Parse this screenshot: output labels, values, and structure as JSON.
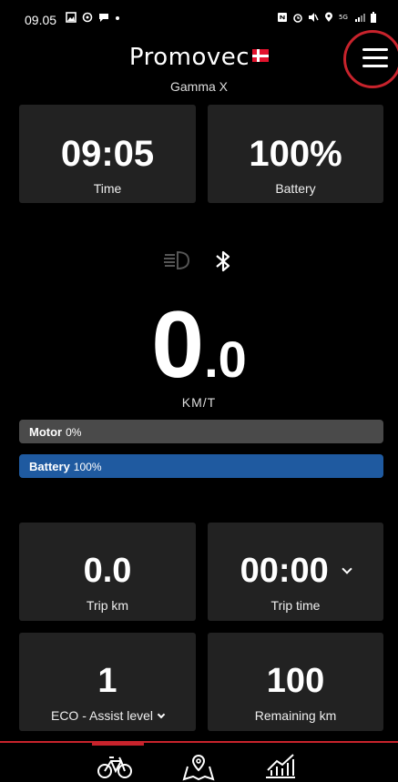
{
  "status_bar": {
    "time": "09.05",
    "icons": [
      "gallery-icon",
      "sync-icon",
      "chat-icon",
      "dot-icon",
      "nfc-icon",
      "alarm-icon",
      "mute-icon",
      "location-icon",
      "5g-icon",
      "signal-icon",
      "battery-icon"
    ]
  },
  "header": {
    "brand": "Promovec",
    "model": "Gamma X",
    "menu_icon": "hamburger-menu-icon",
    "accent_color": "#c8232c"
  },
  "tiles_top": [
    {
      "value": "09:05",
      "label": "Time"
    },
    {
      "value": "100%",
      "label": "Battery"
    }
  ],
  "status_icons": [
    "headlight-icon",
    "bluetooth-icon"
  ],
  "speed": {
    "integer": "0",
    "decimal": ".0",
    "unit": "KM/T"
  },
  "bars": {
    "motor": {
      "label": "Motor",
      "value_text": "0%",
      "fraction": 0.0,
      "color": "#4a4a4a"
    },
    "battery": {
      "label": "Battery",
      "value_text": "100%",
      "fraction": 1.0,
      "color": "#1f5aa0"
    }
  },
  "tiles_bottom": [
    {
      "value": "0.0",
      "label": "Trip km"
    },
    {
      "value": "00:00",
      "label": "Trip time"
    },
    {
      "value": "1",
      "label": "ECO - Assist level"
    },
    {
      "value": "100",
      "label": "Remaining km"
    }
  ],
  "nav": {
    "items": [
      "bicycle-icon",
      "map-icon",
      "statistics-icon"
    ],
    "active": "bicycle-icon"
  }
}
